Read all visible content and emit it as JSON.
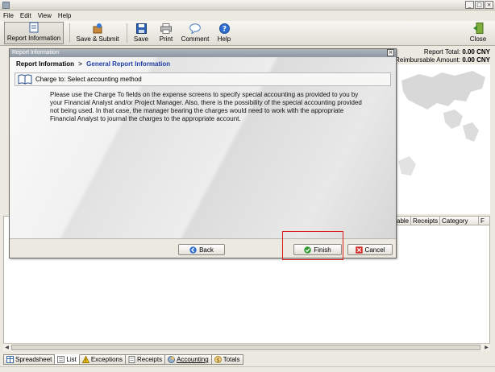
{
  "menubar": {
    "items": [
      "File",
      "Edit",
      "View",
      "Help"
    ]
  },
  "toolbar": {
    "report_information": "Report Information",
    "save_submit": "Save & Submit",
    "save": "Save",
    "print": "Print",
    "comment": "Comment",
    "help": "Help",
    "close": "Close"
  },
  "summary": {
    "report_total_label": "Report Total:",
    "report_total_value": "0.00 CNY",
    "reimbursable_label": "Reimbursable Amount:",
    "reimbursable_value": "0.00 CNY"
  },
  "grid": {
    "columns": [
      "able",
      "Receipts",
      "Category",
      "F"
    ]
  },
  "bottom_tabs": [
    "Spreadsheet",
    "List",
    "Exceptions",
    "Receipts",
    "Accounting",
    "Totals"
  ],
  "dialog": {
    "title": "Report Information",
    "breadcrumb_root": "Report Information",
    "breadcrumb_sep": ">",
    "breadcrumb_current": "General Report Information",
    "step_label": "Charge to: Select accounting method",
    "description": "Please use the Charge To fields on the expense screens to specify special accounting as provided to you by your Financial Analyst and/or Project Manager. Also, there is the possibility of the special accounting provided not being used. In that case, the manager bearing the charges would need to work with the appropriate Financial Analyst to journal the charges to the appropriate account.",
    "back_label": "Back",
    "finish_label": "Finish",
    "cancel_label": "Cancel"
  },
  "colors": {
    "highlight": "#e01c1c",
    "crumb_current": "#1f3ea8",
    "finish_icon": "#2e9a2e",
    "cancel_icon": "#d22a2a"
  },
  "icons": [
    "document-icon",
    "save-submit-icon",
    "floppy-disk-icon",
    "printer-icon",
    "speech-bubble-icon",
    "help-icon",
    "close-door-icon",
    "book-icon",
    "back-arrow-icon",
    "checkmark-icon",
    "cancel-x-icon"
  ]
}
